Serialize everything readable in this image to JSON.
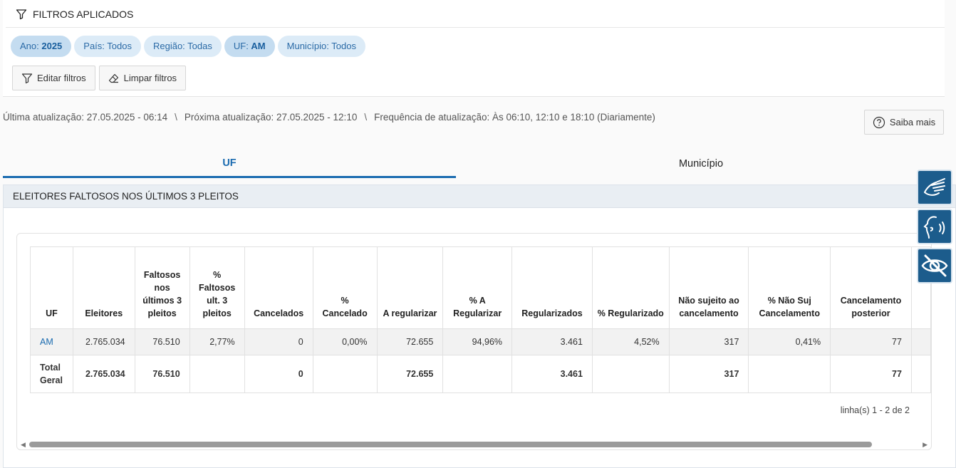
{
  "filters": {
    "title": "FILTROS APLICADOS",
    "chips": [
      {
        "label": "Ano: ",
        "value": "2025"
      },
      {
        "label": "País: Todos",
        "value": ""
      },
      {
        "label": "Região: Todas",
        "value": ""
      },
      {
        "label": "UF: ",
        "value": "AM"
      },
      {
        "label": "Município: Todos",
        "value": ""
      }
    ],
    "edit_label": "Editar filtros",
    "clear_label": "Limpar filtros"
  },
  "update": {
    "last": "Última atualização: 27.05.2025 - 06:14",
    "next": "Próxima atualização: 27.05.2025 - 12:10",
    "freq": "Frequência de atualização: Às 06:10, 12:10 e 18:10 (Diariamente)",
    "sep": "\\",
    "help_label": "Saiba mais"
  },
  "tabs": {
    "uf": "UF",
    "municipio": "Município"
  },
  "section": {
    "title": "ELEITORES FALTOSOS NOS ÚLTIMOS 3 PLEITOS"
  },
  "table": {
    "headers": [
      "UF",
      "Eleitores",
      "Faltosos nos últimos 3 pleitos",
      "% Faltosos ult. 3 pleitos",
      "Cancelados",
      "% Cancelado",
      "A regularizar",
      "% A Regularizar",
      "Regularizados",
      "% Regularizado",
      "Não sujeito ao cancelamento",
      "% Não Suj Cancelamento",
      "Cancelamento posterior"
    ],
    "row": [
      "AM",
      "2.765.034",
      "76.510",
      "2,77%",
      "0",
      "0,00%",
      "72.655",
      "94,96%",
      "3.461",
      "4,52%",
      "317",
      "0,41%",
      "77"
    ],
    "total": [
      "Total Geral",
      "2.765.034",
      "76.510",
      "",
      "0",
      "",
      "72.655",
      "",
      "3.461",
      "",
      "317",
      "",
      "77"
    ]
  },
  "pager": "linha(s) 1 - 2 de 2"
}
